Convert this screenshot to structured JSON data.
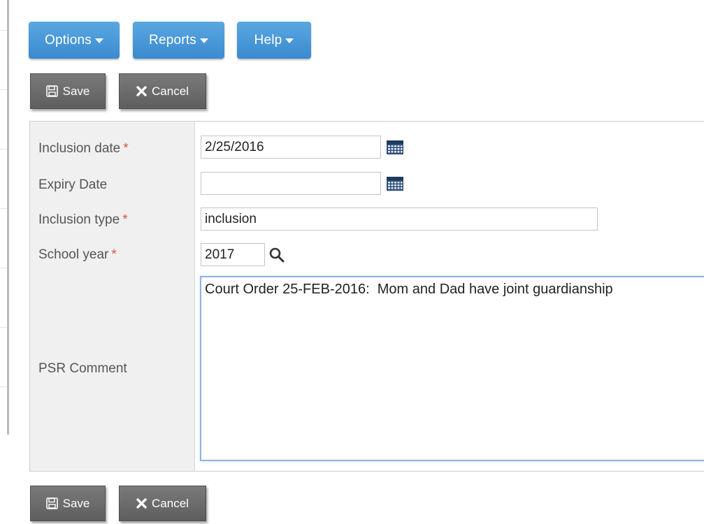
{
  "menu": {
    "options_label": "Options",
    "reports_label": "Reports",
    "help_label": "Help"
  },
  "actions": {
    "save_label": "Save",
    "cancel_label": "Cancel"
  },
  "form": {
    "inclusion_date": {
      "label": "Inclusion date",
      "required_mark": "*",
      "value": "2/25/2016"
    },
    "expiry_date": {
      "label": "Expiry Date",
      "value": ""
    },
    "inclusion_type": {
      "label": "Inclusion type",
      "required_mark": "*",
      "value": "inclusion"
    },
    "school_year": {
      "label": "School year",
      "required_mark": "*",
      "value": "2017"
    },
    "psr_comment": {
      "label": "PSR Comment",
      "value": "Court Order 25-FEB-2016:  Mom and Dad have joint guardianship"
    }
  },
  "colors": {
    "menu_button": "#3a8ad0",
    "action_button": "#6a6a6a",
    "required": "#d9534f",
    "textarea_focus_border": "#8db4e0"
  },
  "icons": {
    "calendar": "calendar-icon",
    "search": "search-icon",
    "save": "floppy-disk-icon",
    "cancel": "x-icon",
    "caret": "caret-down-icon"
  }
}
